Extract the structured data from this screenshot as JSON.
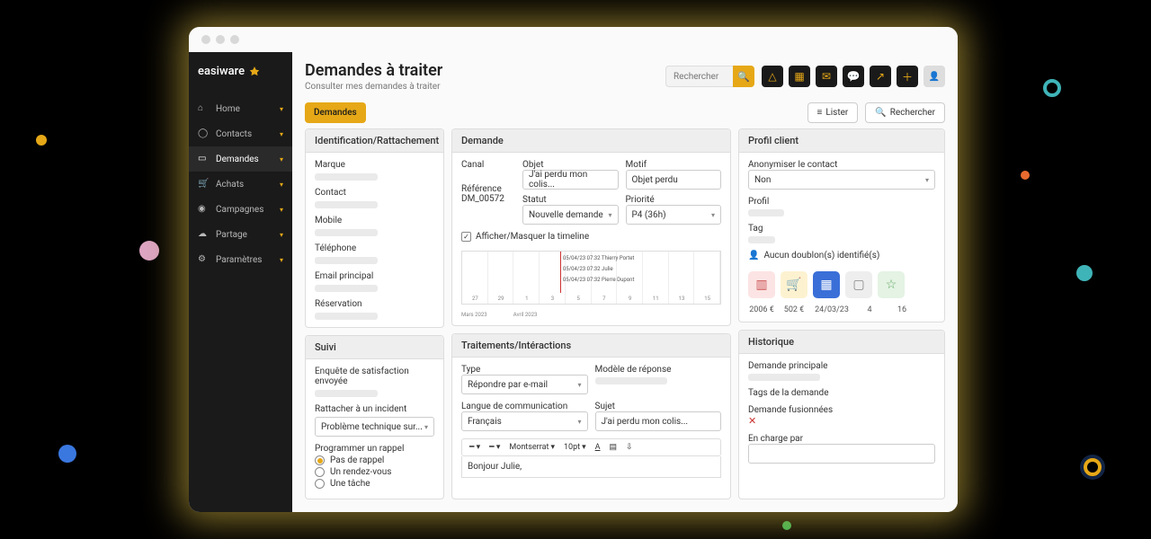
{
  "brand": "easiware",
  "sidebar": {
    "items": [
      {
        "label": "Home"
      },
      {
        "label": "Contacts"
      },
      {
        "label": "Demandes"
      },
      {
        "label": "Achats"
      },
      {
        "label": "Campagnes"
      },
      {
        "label": "Partage"
      },
      {
        "label": "Paramètres"
      }
    ]
  },
  "header": {
    "title": "Demandes à traiter",
    "subtitle": "Consulter mes demandes à traiter",
    "search_placeholder": "Rechercher",
    "tab": "Demandes",
    "lister": "Lister",
    "rechercher": "Rechercher"
  },
  "ident": {
    "title": "Identification/Rattachement",
    "fields": [
      "Marque",
      "Contact",
      "Mobile",
      "Téléphone",
      "Email principal",
      "Réservation"
    ]
  },
  "demande": {
    "title": "Demande",
    "canal": "Canal",
    "reference_lbl": "Référence",
    "reference_val": "DM_00572",
    "objet_lbl": "Objet",
    "objet_val": "J'ai perdu mon colis...",
    "motif_lbl": "Motif",
    "motif_val": "Objet perdu",
    "statut_lbl": "Statut",
    "statut_val": "Nouvelle demande",
    "priorite_lbl": "Priorité",
    "priorite_val": "P4 (36h)",
    "timeline_toggle": "Afficher/Masquer la timeline",
    "timeline": {
      "events": [
        "05/04/23 07:32 Thierry Portet",
        "05/04/23 07:32 Julie",
        "05/04/23 07:32 Pierre Dupont"
      ],
      "ticks": [
        "27",
        "29",
        "1",
        "3",
        "5",
        "7",
        "9",
        "11",
        "13",
        "15"
      ],
      "month1": "Mars 2023",
      "month2": "Avril 2023"
    }
  },
  "profil": {
    "title": "Profil client",
    "anon_lbl": "Anonymiser le contact",
    "anon_val": "Non",
    "profil_lbl": "Profil",
    "tag_lbl": "Tag",
    "doublon": "Aucun doublon(s) identifié(s)",
    "vals": [
      "2006 €",
      "502 €",
      "24/03/23",
      "4",
      "16"
    ]
  },
  "suivi": {
    "title": "Suivi",
    "enquete": "Enquête de satisfaction envoyée",
    "rattacher": "Rattacher à un incident",
    "rattacher_val": "Problème technique sur...",
    "rappel": "Programmer un rappel",
    "r1": "Pas de rappel",
    "r2": "Un rendez-vous",
    "r3": "Une tâche"
  },
  "trait": {
    "title": "Traitements/Intéractions",
    "type_lbl": "Type",
    "type_val": "Répondre par e-mail",
    "modele_lbl": "Modèle de réponse",
    "langue_lbl": "Langue de communication",
    "langue_val": "Français",
    "sujet_lbl": "Sujet",
    "sujet_val": "J'ai perdu mon colis...",
    "font": "Montserrat",
    "size": "10pt",
    "body": "Bonjour Julie,"
  },
  "hist": {
    "title": "Historique",
    "f1": "Demande principale",
    "f2": "Tags de la demande",
    "f3": "Demande fusionnées",
    "f4": "En charge par"
  }
}
